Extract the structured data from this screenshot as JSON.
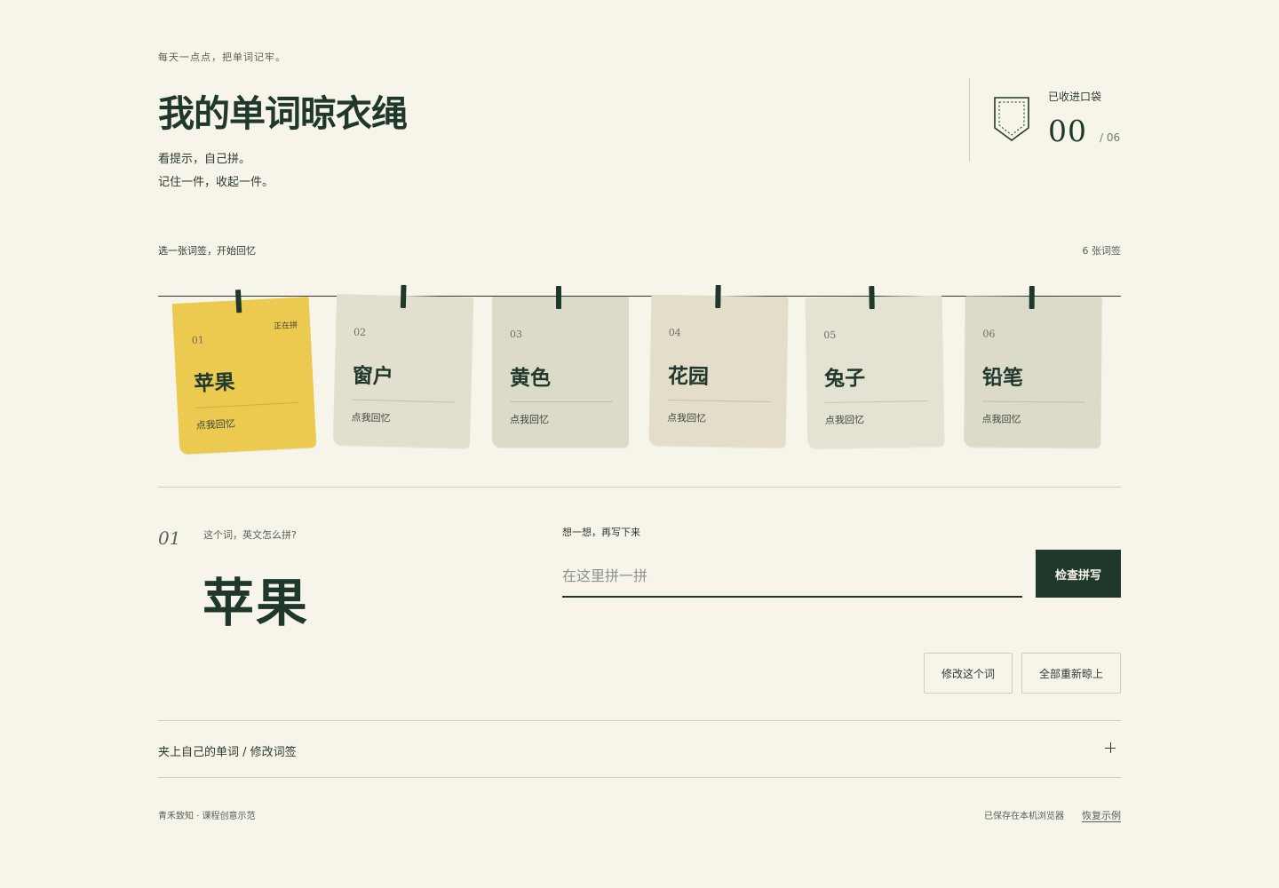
{
  "header": {
    "tagline": "每天一点点，把单词记牢。",
    "title": "我的单词晾衣绳",
    "subtitle_line1": "看提示，自己拼。",
    "subtitle_line2": "记住一件，收起一件。"
  },
  "pocket": {
    "icon": "pocket-icon",
    "label": "已收进口袋",
    "collected": "00",
    "total": "/ 06"
  },
  "clothesline": {
    "prompt": "选一张词签，开始回忆",
    "count_text": "6 张词签",
    "cards": [
      {
        "num": "01",
        "word": "苹果",
        "hint": "点我回忆",
        "status": "正在拼",
        "color": "#ecc94f",
        "active": true
      },
      {
        "num": "02",
        "word": "窗户",
        "hint": "点我回忆",
        "status": "",
        "color": "#e3dfcf",
        "active": false
      },
      {
        "num": "03",
        "word": "黄色",
        "hint": "点我回忆",
        "status": "",
        "color": "#dcdbc9",
        "active": false
      },
      {
        "num": "04",
        "word": "花园",
        "hint": "点我回忆",
        "status": "",
        "color": "#e4ddca",
        "active": false
      },
      {
        "num": "05",
        "word": "兔子",
        "hint": "点我回忆",
        "status": "",
        "color": "#e4e3d3",
        "active": false
      },
      {
        "num": "06",
        "word": "铅笔",
        "hint": "点我回忆",
        "status": "",
        "color": "#dcdbc9",
        "active": false
      }
    ]
  },
  "quiz": {
    "num": "01",
    "question": "这个词，英文怎么拼?",
    "word": "苹果",
    "input_label": "想一想，再写下来",
    "input_placeholder": "在这里拼一拼",
    "input_value": "",
    "check_label": "检查拼写",
    "edit_label": "修改这个词",
    "reset_label": "全部重新晾上"
  },
  "addbar": {
    "label": "夹上自己的单词 / 修改词签",
    "icon": "plus-icon"
  },
  "footer": {
    "credit": "青禾致知 · 课程创意示范",
    "saved": "已保存在本机浏览器",
    "restore": "恢复示例"
  }
}
